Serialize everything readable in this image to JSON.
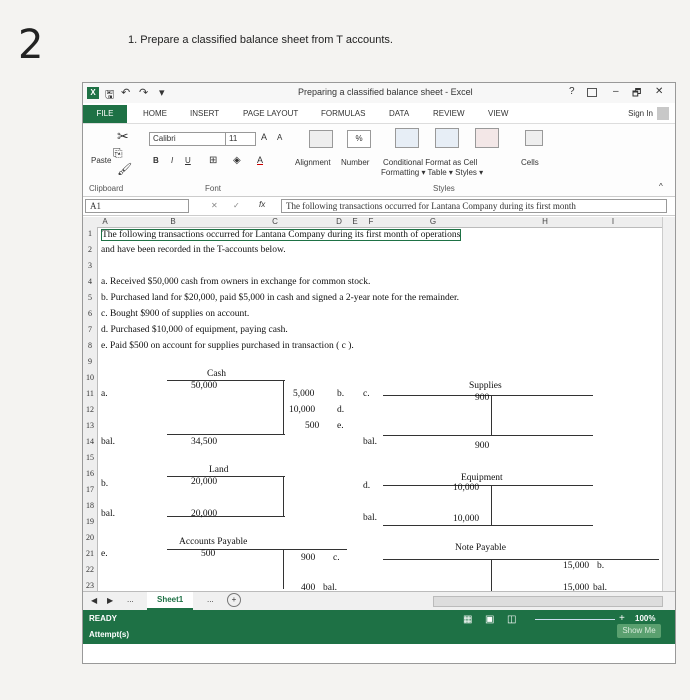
{
  "page": {
    "number": "2",
    "instruction": "1. Prepare a classified balance sheet from T accounts."
  },
  "window": {
    "title": "Preparing a classified balance sheet - Excel",
    "controls": [
      "?",
      "–",
      "✕"
    ],
    "sign_in": "Sign In"
  },
  "tabs": [
    "FILE",
    "HOME",
    "INSERT",
    "PAGE LAYOUT",
    "FORMULAS",
    "DATA",
    "REVIEW",
    "VIEW"
  ],
  "ribbon": {
    "paste": "Paste",
    "font_name": "Calibri",
    "font_size": "11",
    "font_grow": "A",
    "font_shrink": "A",
    "bold": "B",
    "italic": "I",
    "underline": "U",
    "alignment": "Alignment",
    "number": "Number",
    "percent": "%",
    "conditional": "Conditional Format as Cell",
    "formatting": "Formatting ▾ Table ▾ Styles ▾",
    "cells": "Cells",
    "group_clipboard": "Clipboard",
    "group_font": "Font",
    "group_styles": "Styles"
  },
  "formula_bar": {
    "cell_ref": "A1",
    "fx": "fx",
    "content": "The following transactions occurred for Lantana Company during its first month"
  },
  "columns": [
    "A",
    "B",
    "C",
    "D",
    "E",
    "F",
    "G",
    "H",
    "I"
  ],
  "rows": [
    "1",
    "2",
    "3",
    "4",
    "5",
    "6",
    "7",
    "8",
    "9",
    "10",
    "11",
    "12",
    "13",
    "14",
    "15",
    "16",
    "17",
    "18",
    "19",
    "20",
    "21",
    "22",
    "23",
    "24"
  ],
  "text_lines": {
    "r1": "The following transactions occurred for Lantana Company during its first month of operations",
    "r2": "and have been recorded in the T-accounts below.",
    "r4": "a. Received $50,000 cash from owners in exchange for common stock.",
    "r5": "b. Purchased land for $20,000, paid $5,000 in cash and signed a 2-year note for the remainder.",
    "r6": "c. Bought $900 of supplies on account.",
    "r7": "d. Purchased $10,000 of equipment, paying cash.",
    "r8": "e. Paid $500 on account for supplies purchased in transaction ( c )."
  },
  "t_accounts": {
    "cash": {
      "title": "Cash",
      "debit1_label": "a.",
      "debit1": "50,000",
      "credits": [
        "5,000",
        "10,000",
        "500"
      ],
      "credit_labels": [
        "b.",
        "d.",
        "e."
      ],
      "bal_label": "bal.",
      "bal": "34,500"
    },
    "supplies": {
      "title": "Supplies",
      "debit": "900",
      "credit_label": "c.",
      "bal_label": "bal.",
      "bal": "900"
    },
    "land": {
      "title": "Land",
      "debit_label": "b.",
      "debit": "20,000",
      "bal_label": "bal.",
      "bal": "20,000"
    },
    "equipment": {
      "title": "Equipment",
      "debit_label": "d.",
      "debit": "10,000",
      "bal_label": "bal.",
      "bal": "10,000"
    },
    "ap": {
      "title": "Accounts Payable",
      "debit_label": "e.",
      "debit": "500",
      "credit": "900",
      "credit_label": "c.",
      "bal": "400",
      "bal_label": "bal."
    },
    "np": {
      "title": "Note Payable",
      "credit": "15,000",
      "credit_label": "b.",
      "bal": "15,000",
      "bal_label": "bal."
    }
  },
  "sheet": {
    "name": "Sheet1",
    "dots": "...",
    "add": "+"
  },
  "status": {
    "ready": "READY",
    "attempt": "Attempt(s)",
    "zoom": "100%",
    "zoom_plus": "+",
    "show_me": "Show Me"
  }
}
